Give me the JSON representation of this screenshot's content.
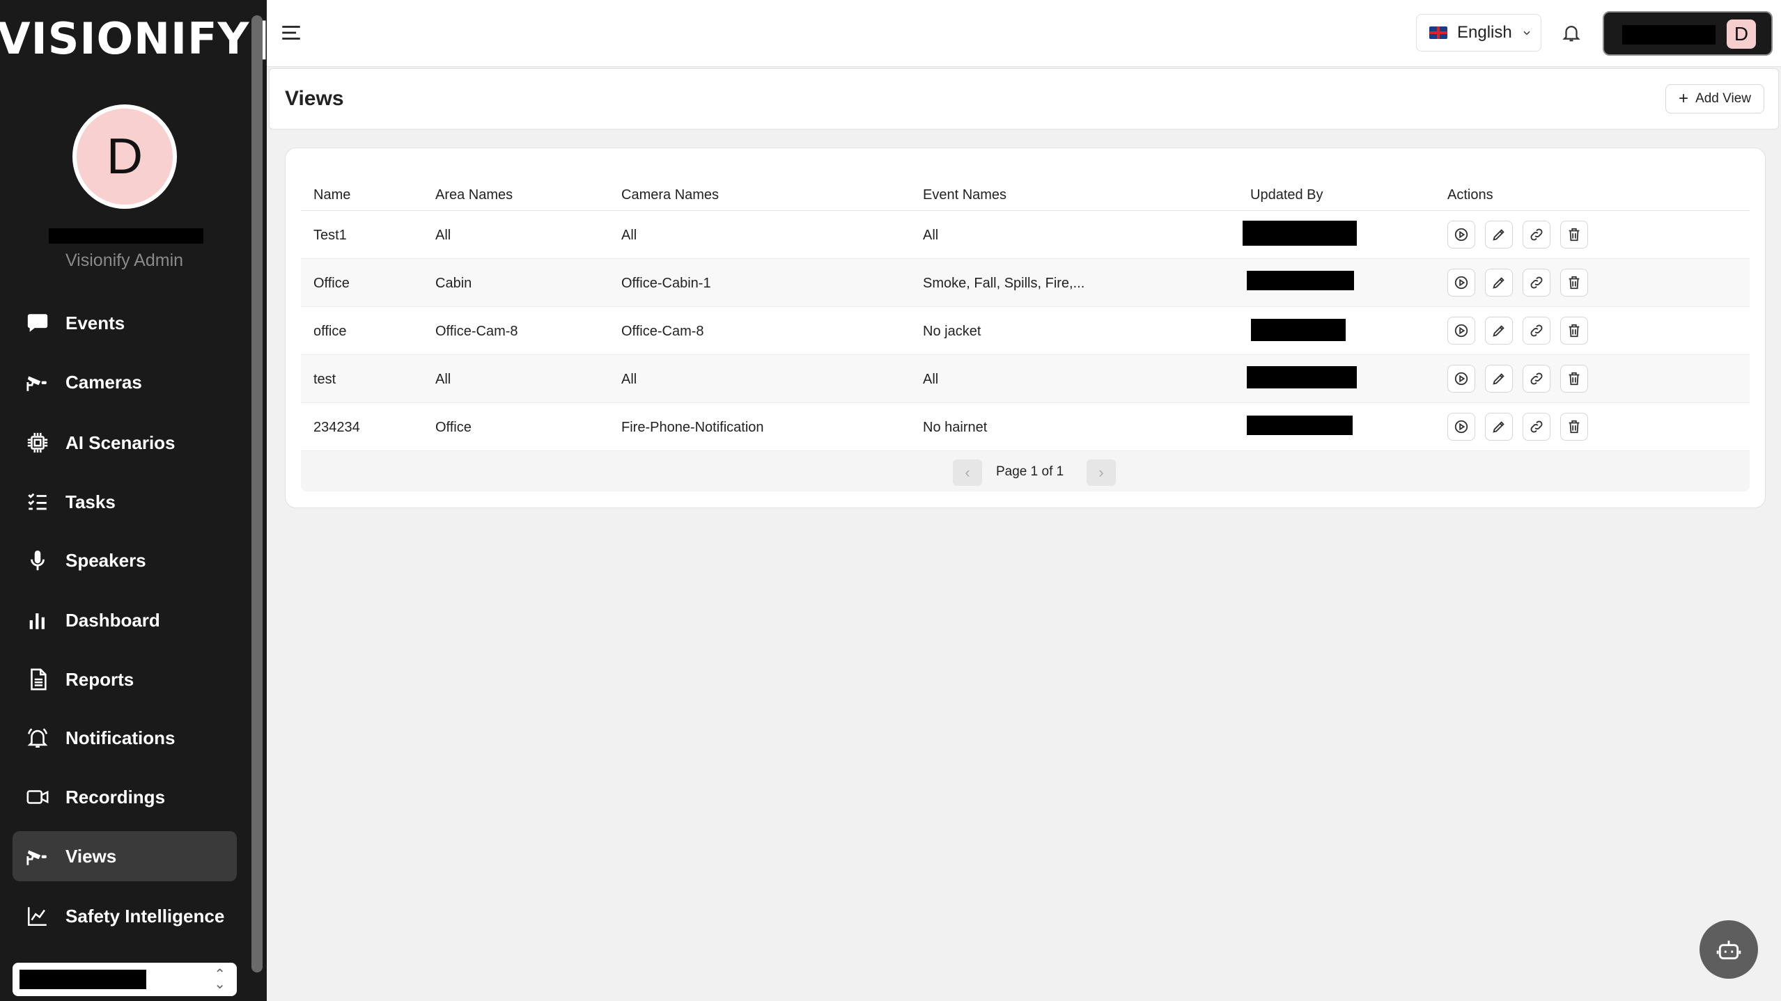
{
  "brand": {
    "logo_text": "[VISIONIFY]"
  },
  "user": {
    "initial": "D",
    "role": "Visionify Admin"
  },
  "sidebar": {
    "items": [
      {
        "label": "Events",
        "icon": "chat-bubble-icon"
      },
      {
        "label": "Cameras",
        "icon": "cctv-camera-icon"
      },
      {
        "label": "AI Scenarios",
        "icon": "chip-icon"
      },
      {
        "label": "Tasks",
        "icon": "checklist-icon"
      },
      {
        "label": "Speakers",
        "icon": "microphone-icon"
      },
      {
        "label": "Dashboard",
        "icon": "bar-chart-icon"
      },
      {
        "label": "Reports",
        "icon": "document-icon"
      },
      {
        "label": "Notifications",
        "icon": "bell-ring-icon"
      },
      {
        "label": "Recordings",
        "icon": "video-camera-icon"
      },
      {
        "label": "Views",
        "icon": "cctv-camera-icon",
        "active": true
      },
      {
        "label": "Safety Intelligence",
        "icon": "line-chart-icon"
      }
    ]
  },
  "topbar": {
    "language": "English"
  },
  "header": {
    "title": "Views",
    "add_label": "Add View"
  },
  "table": {
    "columns": [
      "Name",
      "Area Names",
      "Camera Names",
      "Event Names",
      "Updated By",
      "Actions"
    ],
    "rows": [
      {
        "name": "Test1",
        "area": "All",
        "camera": "All",
        "event": "All"
      },
      {
        "name": "Office",
        "area": "Cabin",
        "camera": "Office-Cabin-1",
        "event": "Smoke, Fall, Spills, Fire,..."
      },
      {
        "name": "office",
        "area": "Office-Cam-8",
        "camera": "Office-Cam-8",
        "event": "No jacket"
      },
      {
        "name": "test",
        "area": "All",
        "camera": "All",
        "event": "All"
      },
      {
        "name": "234234",
        "area": "Office",
        "camera": "Fire-Phone-Notification",
        "event": "No hairnet"
      }
    ],
    "pagination": "Page 1 of 1"
  },
  "colors": {
    "sidebar_bg": "#1a1a1a",
    "active_item": "#3a3a3a",
    "avatar_bg": "#f8d0d0"
  }
}
